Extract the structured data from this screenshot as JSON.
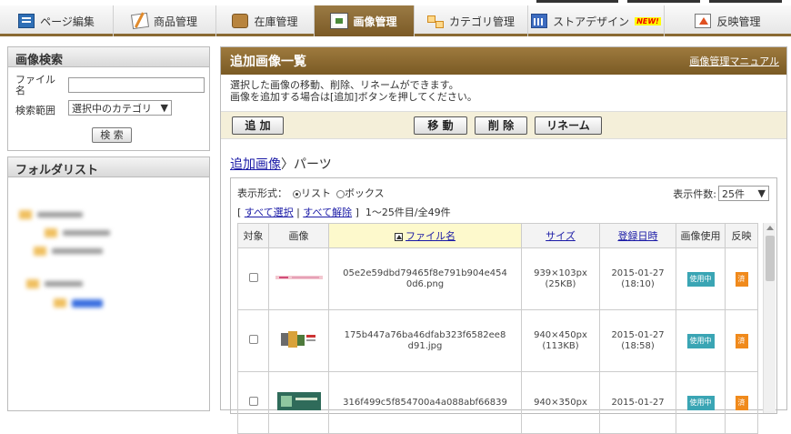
{
  "nav": {
    "tabs": [
      {
        "label": "ページ編集",
        "icon": "page-edit-icon"
      },
      {
        "label": "商品管理",
        "icon": "goods-icon"
      },
      {
        "label": "在庫管理",
        "icon": "stock-icon"
      },
      {
        "label": "画像管理",
        "icon": "image-icon",
        "active": true
      },
      {
        "label": "カテゴリ管理",
        "icon": "category-icon"
      },
      {
        "label": "ストアデザイン",
        "icon": "design-icon",
        "badge": "NEW!"
      },
      {
        "label": "反映管理",
        "icon": "reflect-icon"
      }
    ]
  },
  "search": {
    "title": "画像検索",
    "file_label": "ファイル名",
    "file_value": "",
    "scope_label": "検索範囲",
    "scope_value": "選択中のカテゴリ",
    "button": "検 索"
  },
  "folders": {
    "title": "フォルダリスト"
  },
  "main": {
    "title": "追加画像一覧",
    "manual_link": "画像管理マニュアル",
    "desc_line1": "選択した画像の移動、削除、リネームができます。",
    "desc_line2": "画像を追加する場合は[追加]ボタンを押してください。",
    "buttons": {
      "add": "追 加",
      "move": "移 動",
      "delete": "削 除",
      "rename": "リネーム"
    },
    "breadcrumb_link": "追加画像",
    "breadcrumb_sep": "〉",
    "breadcrumb_current": "パーツ"
  },
  "list": {
    "display_label": "表示形式：",
    "opt_list": "リスト",
    "opt_box": "ボックス",
    "count_label": "表示件数:",
    "count_value": "25件",
    "select_all": "すべて選択",
    "deselect_all": "すべて解除",
    "range": "1〜25件目/全49件",
    "headers": {
      "target": "対象",
      "image": "画像",
      "filename": "ファイル名",
      "size": "サイズ",
      "date": "登録日時",
      "usage": "画像使用",
      "reflect": "反映"
    },
    "rows": [
      {
        "filename": "05e2e59dbd79465f8e791b904e4540d6.png",
        "size": "939×103px",
        "kb": "(25KB)",
        "date": "2015-01-27",
        "time": "(18:10)",
        "usage": "使用中",
        "reflect": "済"
      },
      {
        "filename": "175b447a76ba46dfab323f6582ee8d91.jpg",
        "size": "940×450px",
        "kb": "(113KB)",
        "date": "2015-01-27",
        "time": "(18:58)",
        "usage": "使用中",
        "reflect": "済"
      },
      {
        "filename": "316f499c5f854700a4a088abf66839",
        "size": "940×350px",
        "kb": "",
        "date": "2015-01-27",
        "time": "",
        "usage": "使用中",
        "reflect": "済"
      }
    ]
  }
}
